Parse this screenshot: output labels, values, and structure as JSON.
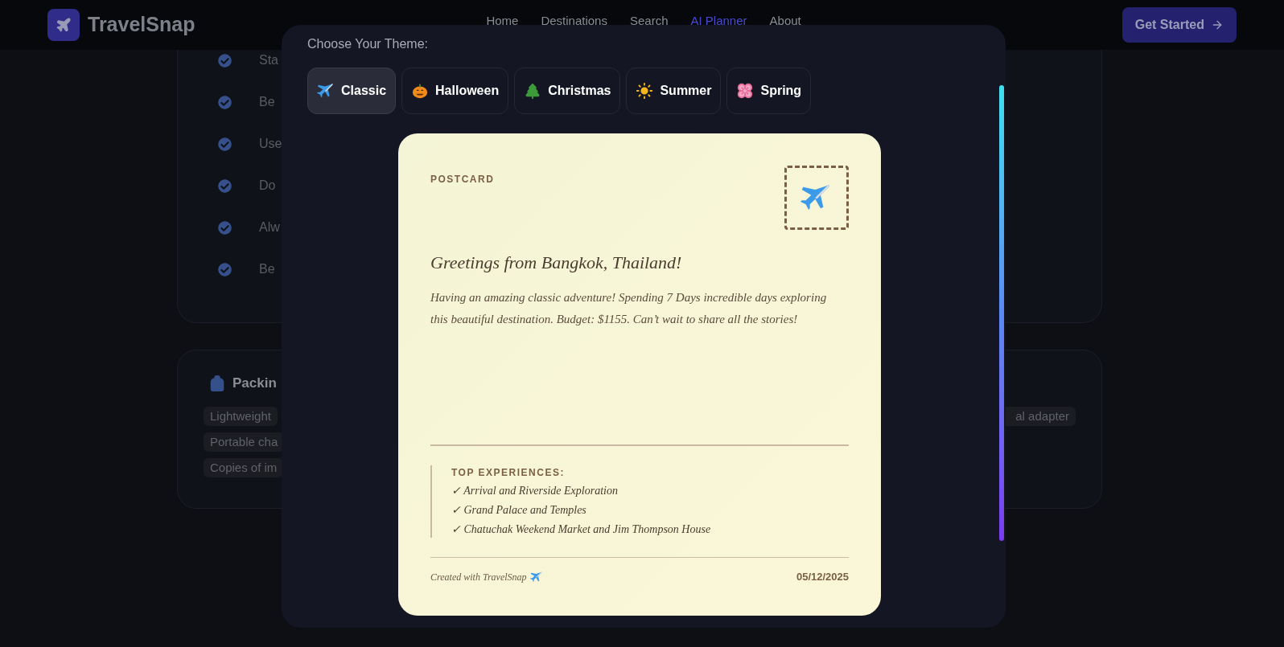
{
  "header": {
    "logo": "TravelSnap",
    "nav": [
      {
        "label": "Home",
        "selected": false
      },
      {
        "label": "Destinations",
        "selected": false
      },
      {
        "label": "Search",
        "selected": false
      },
      {
        "label": "AI Planner",
        "selected": true
      },
      {
        "label": "About",
        "selected": false
      }
    ],
    "cta": "Get Started"
  },
  "background": {
    "checklist": [
      "Sta",
      "Be",
      "Use",
      "Do",
      "Alw",
      "Be"
    ],
    "packing": {
      "title": "Packin",
      "tags_left": [
        "Lightweight",
        "Portable cha",
        "Copies of im"
      ],
      "tags_right": [
        "al adapter"
      ]
    }
  },
  "modal": {
    "title": "Choose Your Theme:",
    "themes": [
      {
        "label": "Classic",
        "selected": true
      },
      {
        "label": "Halloween",
        "selected": false
      },
      {
        "label": "Christmas",
        "selected": false
      },
      {
        "label": "Summer",
        "selected": false
      },
      {
        "label": "Spring",
        "selected": false
      }
    ],
    "postcard": {
      "label": "POSTCARD",
      "greeting": "Greetings from Bangkok, Thailand!",
      "message": "Having an amazing classic adventure! Spending 7 Days incredible days exploring this beautiful destination. Budget: $1155. Can’t wait to share all the stories!",
      "experiences_title": "TOP EXPERIENCES:",
      "experiences": [
        "✓ Arrival and Riverside Exploration",
        "✓ Grand Palace and Temples",
        "✓ Chatuchak Weekend Market and Jim Thompson House"
      ],
      "footer": "Created with TravelSnap",
      "date": "05/12/2025"
    }
  }
}
